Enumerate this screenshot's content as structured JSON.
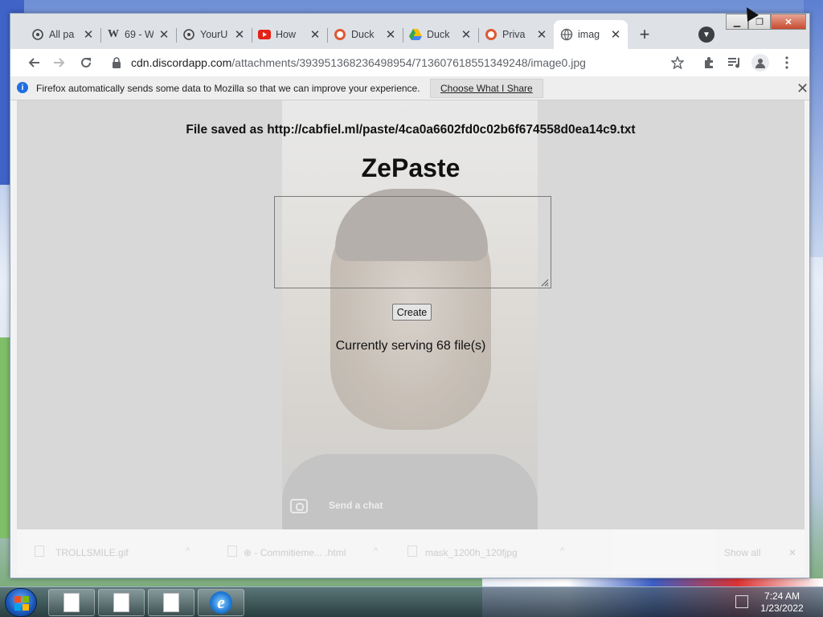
{
  "browser": {
    "tabs": [
      {
        "title": "All pa",
        "icon": "extension-icon"
      },
      {
        "title": "69 - W",
        "icon": "wikipedia-icon"
      },
      {
        "title": "YourU",
        "icon": "extension-icon"
      },
      {
        "title": "How",
        "icon": "youtube-icon"
      },
      {
        "title": "Duck",
        "icon": "duckduckgo-icon"
      },
      {
        "title": "Duck",
        "icon": "drive-icon"
      },
      {
        "title": "Priva",
        "icon": "duckduckgo-icon"
      },
      {
        "title": "imag",
        "icon": "globe-icon",
        "active": true
      }
    ],
    "address": {
      "domain": "cdn.discordapp.com",
      "path": "/attachments/393951368236498954/713607618551349248/image0.jpg"
    },
    "infobar": {
      "message": "Firefox automatically sends some data to Mozilla so that we can improve your experience.",
      "button_label": "Choose What I Share"
    }
  },
  "page": {
    "saved_message": "File saved as http://cabfiel.ml/paste/4ca0a6602fd0c02b6f674558d0ea14c9.txt",
    "title": "ZePaste",
    "textarea_value": "",
    "create_label": "Create",
    "serving_text": "Currently serving 68 file(s)",
    "photo_hint": "Send a chat"
  },
  "downloads": {
    "items": [
      {
        "name": "TROLLSMILE.gif"
      },
      {
        "name": "⊕ - Commitieme... .html"
      },
      {
        "name": "mask_1200h_120fjpg"
      }
    ],
    "show_all": "Show all"
  },
  "taskbar": {
    "time": "7:24 AM",
    "date": "1/23/2022"
  },
  "colors": {
    "accent": "#1a73e8",
    "content_overlay": "#d8d8d8",
    "infobar_icon": "#1f6fe0"
  }
}
